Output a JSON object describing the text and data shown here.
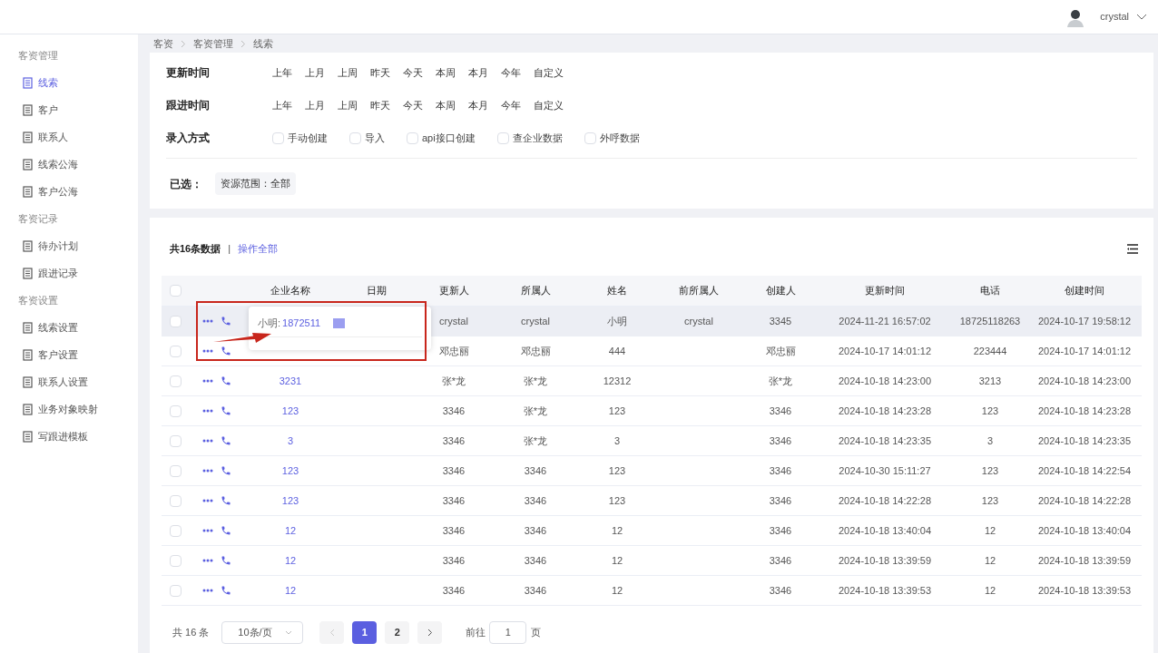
{
  "user": {
    "name": "crystal"
  },
  "sidebar": {
    "groups": [
      {
        "title": "客资管理",
        "items": [
          {
            "label": "线索",
            "selected": true
          },
          {
            "label": "客户",
            "selected": false
          },
          {
            "label": "联系人",
            "selected": false
          },
          {
            "label": "线索公海",
            "selected": false
          },
          {
            "label": "客户公海",
            "selected": false
          }
        ]
      },
      {
        "title": "客资记录",
        "items": [
          {
            "label": "待办计划",
            "selected": false
          },
          {
            "label": "跟进记录",
            "selected": false
          }
        ]
      },
      {
        "title": "客资设置",
        "items": [
          {
            "label": "线索设置",
            "selected": false
          },
          {
            "label": "客户设置",
            "selected": false
          },
          {
            "label": "联系人设置",
            "selected": false
          },
          {
            "label": "业务对象映射",
            "selected": false
          },
          {
            "label": "写跟进模板",
            "selected": false
          }
        ]
      }
    ]
  },
  "breadcrumb": [
    "客资",
    "客资管理",
    "线索"
  ],
  "filters": [
    {
      "label": "更新时间",
      "kind": "options",
      "options": [
        "上年",
        "上月",
        "上周",
        "昨天",
        "今天",
        "本周",
        "本月",
        "今年",
        "自定义"
      ]
    },
    {
      "label": "跟进时间",
      "kind": "options",
      "options": [
        "上年",
        "上月",
        "上周",
        "昨天",
        "今天",
        "本周",
        "本月",
        "今年",
        "自定义"
      ]
    },
    {
      "label": "录入方式",
      "kind": "checkboxes",
      "options": [
        {
          "label": "手动创建",
          "checked": false
        },
        {
          "label": "导入",
          "checked": false
        },
        {
          "label": "api接口创建",
          "checked": false
        },
        {
          "label": "查企业数据",
          "checked": false
        },
        {
          "label": "外呼数据",
          "checked": false
        }
      ]
    }
  ],
  "selected_filters": {
    "label": "已选：",
    "tags": [
      "资源范围：全部"
    ]
  },
  "table": {
    "total": "共16条数据",
    "separator": "|",
    "action_all": "操作全部",
    "all_checked": false,
    "columns": [
      "企业名称",
      "日期",
      "更新人",
      "所属人",
      "姓名",
      "前所属人",
      "创建人",
      "更新时间",
      "电话",
      "创建时间"
    ],
    "rows": [
      {
        "highlighted": true,
        "checked": false,
        "updater": "crystal",
        "owner": "crystal",
        "name": "小明",
        "prev_owner": "crystal",
        "creator": "3345",
        "updated": "2024-11-21 16:57:02",
        "phone": "18725118263",
        "created": "2024-10-17 19:58:12"
      },
      {
        "highlighted": false,
        "checked": false,
        "updater": "邓忠丽",
        "owner": "邓忠丽",
        "name": "444",
        "creator": "邓忠丽",
        "updated": "2024-10-17 14:01:12",
        "phone": "223444",
        "created": "2024-10-17 14:01:12"
      },
      {
        "highlighted": false,
        "checked": false,
        "company": "3231",
        "updater": "张*龙",
        "owner": "张*龙",
        "name": "12312",
        "creator": "张*龙",
        "updated": "2024-10-18 14:23:00",
        "phone": "3213",
        "created": "2024-10-18 14:23:00"
      },
      {
        "highlighted": false,
        "checked": false,
        "company": "123",
        "updater": "3346",
        "owner": "张*龙",
        "name": "123",
        "creator": "3346",
        "updated": "2024-10-18 14:23:28",
        "phone": "123",
        "created": "2024-10-18 14:23:28"
      },
      {
        "highlighted": false,
        "checked": false,
        "company": "3",
        "updater": "3346",
        "owner": "张*龙",
        "name": "3",
        "creator": "3346",
        "updated": "2024-10-18 14:23:35",
        "phone": "3",
        "created": "2024-10-18 14:23:35"
      },
      {
        "highlighted": false,
        "checked": false,
        "company": "123",
        "updater": "3346",
        "owner": "3346",
        "name": "123",
        "creator": "3346",
        "updated": "2024-10-30 15:11:27",
        "phone": "123",
        "created": "2024-10-18 14:22:54"
      },
      {
        "highlighted": false,
        "checked": false,
        "company": "123",
        "updater": "3346",
        "owner": "3346",
        "name": "123",
        "creator": "3346",
        "updated": "2024-10-18 14:22:28",
        "phone": "123",
        "created": "2024-10-18 14:22:28"
      },
      {
        "highlighted": false,
        "checked": false,
        "company": "12",
        "updater": "3346",
        "owner": "3346",
        "name": "12",
        "creator": "3346",
        "updated": "2024-10-18 13:40:04",
        "phone": "12",
        "created": "2024-10-18 13:40:04"
      },
      {
        "highlighted": false,
        "checked": false,
        "company": "12",
        "updater": "3346",
        "owner": "3346",
        "name": "12",
        "creator": "3346",
        "updated": "2024-10-18 13:39:59",
        "phone": "12",
        "created": "2024-10-18 13:39:59"
      },
      {
        "highlighted": false,
        "checked": false,
        "company": "12",
        "updater": "3346",
        "owner": "3346",
        "name": "12",
        "creator": "3346",
        "updated": "2024-10-18 13:39:53",
        "phone": "12",
        "created": "2024-10-18 13:39:53"
      }
    ]
  },
  "popover": {
    "label": "小明:",
    "phone": "1872511"
  },
  "pagination": {
    "total": "共 16 条",
    "page_size": "10条/页",
    "pages": [
      {
        "label": "1",
        "selected": true
      },
      {
        "label": "2",
        "selected": false
      }
    ],
    "goto_label": "前往",
    "goto_value": "1",
    "goto_suffix": "页"
  }
}
